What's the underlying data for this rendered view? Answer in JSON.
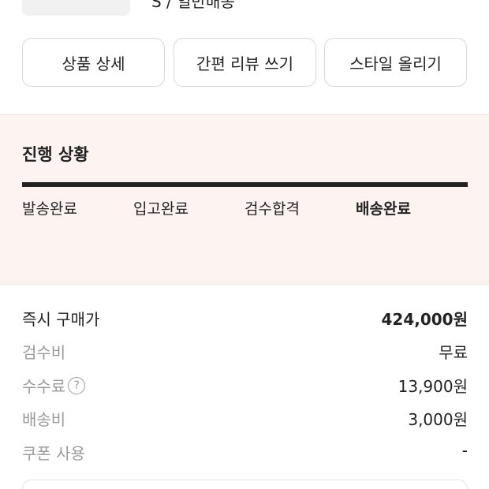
{
  "product": {
    "option_text": "S / 일반배송"
  },
  "actions": {
    "detail_label": "상품 상세",
    "review_label": "간편 리뷰 쓰기",
    "style_label": "스타일 올리기"
  },
  "progress": {
    "title": "진행 상황",
    "steps": [
      {
        "label": "발송완료"
      },
      {
        "label": "입고완료"
      },
      {
        "label": "검수합격"
      },
      {
        "label": "배송완료"
      }
    ],
    "current_step_index": 3,
    "fill_fraction": 1.0
  },
  "price": {
    "rows": [
      {
        "label": "즉시 구매가",
        "value": "424,000원"
      },
      {
        "label": "검수비",
        "value": "무료"
      },
      {
        "label": "수수료",
        "value": "13,900원",
        "help_icon": "question-circle-icon",
        "help_glyph": "?"
      },
      {
        "label": "배송비",
        "value": "3,000원"
      },
      {
        "label": "쿠폰 사용",
        "value": "-"
      }
    ]
  },
  "colors": {
    "progress_bg": "#fdf3f1",
    "text_primary": "#222222",
    "text_muted": "#9a9a9a"
  }
}
